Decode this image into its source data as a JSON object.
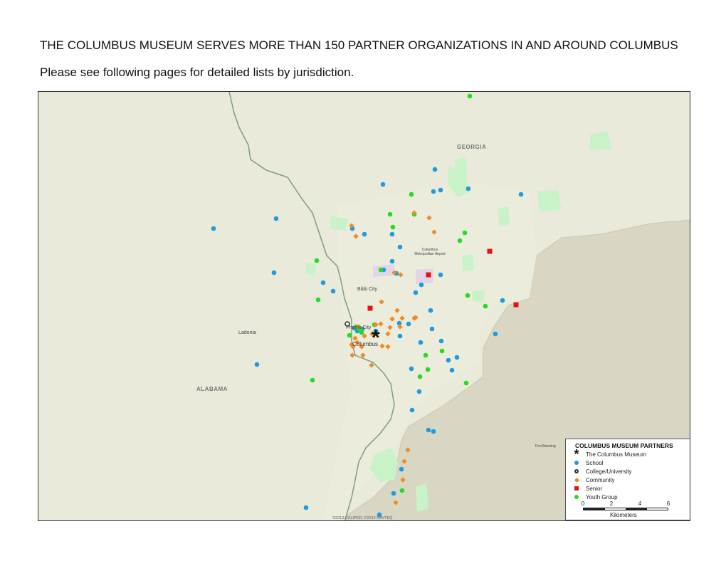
{
  "page": {
    "heading": "THE COLUMBUS MUSEUM SERVES MORE THAN 150 PARTNER ORGANIZATIONS IN AND AROUND COLUMBUS",
    "subheading": "Please see following pages for detailed lists by jurisdiction."
  },
  "map": {
    "labels": {
      "georgia": "GEORGIA",
      "alabama": "ALABAMA",
      "ladonia": "Ladonia",
      "bibb_city": "Bibb City",
      "phenix_city": "Phenix City",
      "columbus": "Columbus",
      "airport": "Columbus Metropolitan Airport",
      "fort_benning": "Fort Benning",
      "copyright": "©2013 CALIPER; ©2012 NAVTEQ"
    },
    "colors": {
      "school": "#1f9be0",
      "community": "#f08a24",
      "senior": "#e31414",
      "youth": "#22dd22",
      "land": "#e9ead9",
      "base": "#d9d7c4",
      "park": "#c8f2c8"
    }
  },
  "legend": {
    "title": "COLUMBUS MUSEUM PARTNERS",
    "items": {
      "museum": "The Columbus Museum",
      "school": "School",
      "college": "College/University",
      "community": "Community",
      "senior": "Senior",
      "youth": "Youth Group"
    },
    "scale_ticks": [
      "0",
      "2",
      "4",
      "6"
    ],
    "scale_unit": "Kilometers"
  }
}
